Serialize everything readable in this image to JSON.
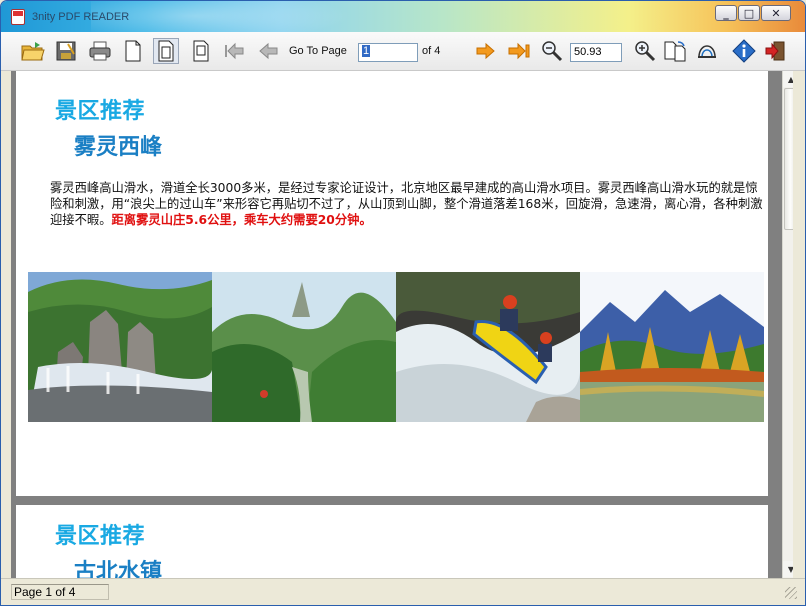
{
  "window": {
    "title": "3nity PDF READER",
    "controls": {
      "minimize": "_",
      "maximize": "□",
      "close": "✕"
    }
  },
  "toolbar": {
    "go_to_page_label": "Go To Page",
    "current_page": "1",
    "of_label": "of 4",
    "zoom_value": "50.93",
    "icons": [
      "open-folder-icon",
      "save-icon",
      "print-icon",
      "blank-page-icon",
      "single-page-icon",
      "fit-page-icon",
      "first-page-icon",
      "previous-page-icon",
      "next-page-icon",
      "last-page-icon",
      "zoom-out-icon",
      "zoom-in-icon",
      "rotate-icon",
      "properties-icon",
      "info-icon",
      "exit-icon"
    ]
  },
  "document": {
    "pages": [
      {
        "heading": "景区推荐",
        "subheading": "雾灵西峰",
        "paragraph": "雾灵西峰高山滑水，滑道全长3000多米，是经过专家论证设计，北京地区最早建成的高山滑水项目。雾灵西峰高山滑水玩的就是惊险和刺激，用“浪尖上的过山车”来形容它再贴切不过了，从山顶到山脚，整个滑道落差168米，回旋滑，急速滑，离心滑，各种刺激迎接不暇。",
        "highlight": "距离雾灵山庄5.6公里，乘车大约需要20分钟。",
        "photos": [
          "rock-waterfall-photo",
          "green-mountain-valley-photo",
          "whitewater-rafting-photo",
          "autumn-lake-mountain-photo"
        ]
      },
      {
        "heading": "景区推荐",
        "subheading": "古北水镇"
      }
    ]
  },
  "status": {
    "page_text": "Page 1 of 4"
  },
  "colors": {
    "heading": "#19a9e3",
    "subheading": "#1a7fc4",
    "highlight": "#e01010",
    "viewer_bg": "#808080"
  }
}
